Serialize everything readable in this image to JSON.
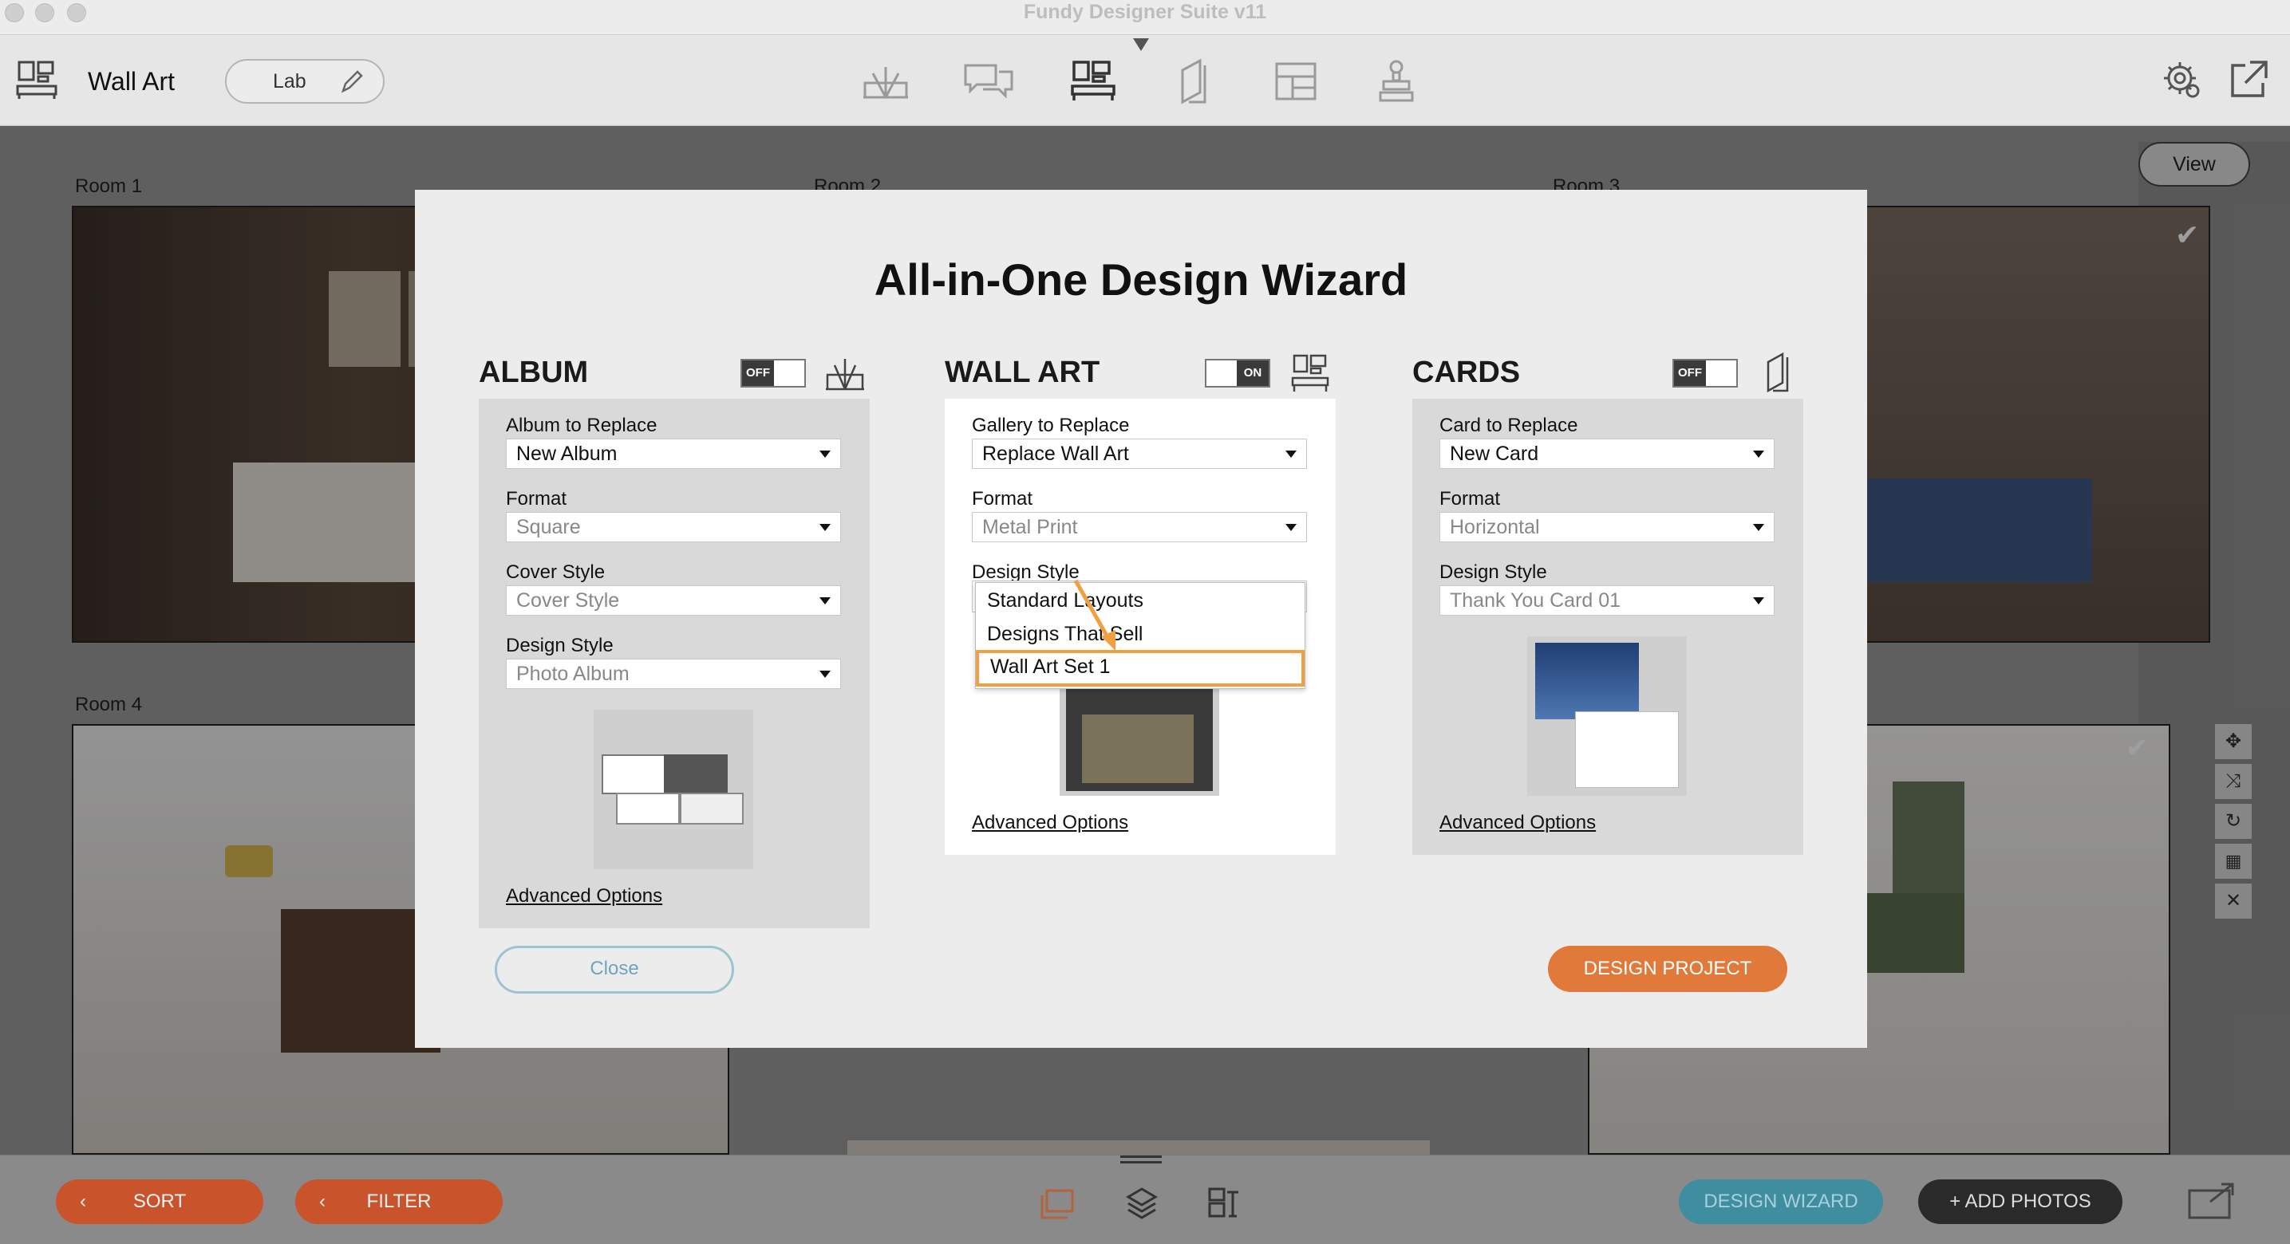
{
  "window": {
    "title": "Fundy Designer Suite v11"
  },
  "toolbar": {
    "section_title": "Wall Art",
    "lab_label": "Lab"
  },
  "background": {
    "view_button": "View",
    "rooms": [
      "Room 1",
      "Room 2",
      "Room 3",
      "Room 4"
    ]
  },
  "bottom": {
    "sort": "SORT",
    "filter": "FILTER",
    "design_wizard": "DESIGN WIZARD",
    "add_photos": "+ ADD PHOTOS"
  },
  "modal": {
    "title": "All-in-One Design Wizard",
    "close": "Close",
    "design_project": "DESIGN PROJECT",
    "album": {
      "title": "ALBUM",
      "toggle": "OFF",
      "fields": [
        {
          "label": "Album to Replace",
          "value": "New Album"
        },
        {
          "label": "Format",
          "value": "Square"
        },
        {
          "label": "Cover Style",
          "value": "Cover Style"
        },
        {
          "label": "Design Style",
          "value": "Photo Album"
        }
      ],
      "advanced": "Advanced Options"
    },
    "wall_art": {
      "title": "WALL ART",
      "toggle": "ON",
      "fields": [
        {
          "label": "Gallery to Replace",
          "value": "Replace Wall Art"
        },
        {
          "label": "Format",
          "value": "Metal Print"
        },
        {
          "label": "Design Style",
          "value": ""
        }
      ],
      "dropdown_options": [
        "Standard Layouts",
        "Designs That Sell",
        "Wall Art Set 1"
      ],
      "advanced": "Advanced Options"
    },
    "cards": {
      "title": "CARDS",
      "toggle": "OFF",
      "fields": [
        {
          "label": "Card to Replace",
          "value": "New Card"
        },
        {
          "label": "Format",
          "value": "Horizontal"
        },
        {
          "label": "Design Style",
          "value": "Thank You Card 01"
        }
      ],
      "advanced": "Advanced Options"
    }
  },
  "colors": {
    "accent_orange": "#e0793a",
    "highlight_orange": "#f0a040",
    "close_blue": "#6fa4ba",
    "wizard_teal": "#3f8ea0"
  }
}
